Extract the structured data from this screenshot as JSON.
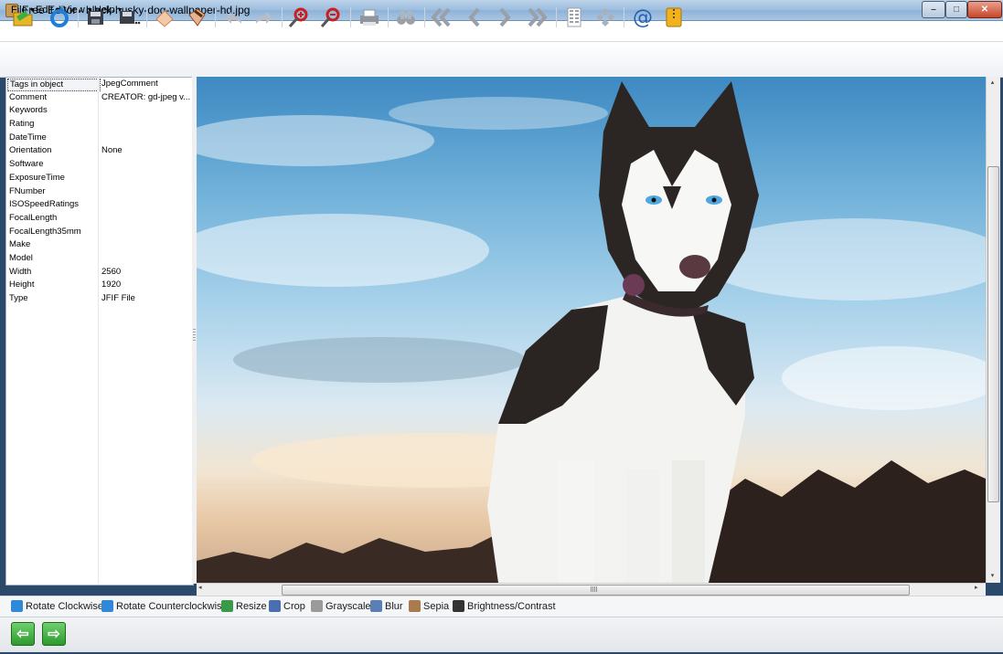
{
  "window": {
    "title": "Free Editor - black-husky-dog-wallpaper-hd.jpg",
    "controls": {
      "minimize": "–",
      "maximize": "□",
      "close": "✕"
    }
  },
  "menubar": [
    {
      "label": "File"
    },
    {
      "label": "Edit"
    },
    {
      "label": "View"
    },
    {
      "label": "Help"
    }
  ],
  "toolbar": {
    "icons": [
      "open-folder-icon",
      "refresh-icon",
      "save-icon",
      "save-as-icon",
      "eraser-icon",
      "paste-icon",
      "undo-icon",
      "redo-icon",
      "zoom-in-icon",
      "zoom-out-icon",
      "print-icon",
      "binoculars-icon",
      "first-icon",
      "previous-icon",
      "next-icon",
      "last-icon",
      "grid-icon",
      "fit-icon",
      "email-icon",
      "archive-icon"
    ]
  },
  "properties": {
    "header": {
      "key": "Tags in object",
      "value": "JpegComment"
    },
    "rows": [
      {
        "key": "Comment",
        "value": "CREATOR: gd-jpeg v..."
      },
      {
        "key": "Keywords",
        "value": ""
      },
      {
        "key": "Rating",
        "value": ""
      },
      {
        "key": "DateTime",
        "value": ""
      },
      {
        "key": "Orientation",
        "value": "None"
      },
      {
        "key": "Software",
        "value": ""
      },
      {
        "key": "ExposureTime",
        "value": ""
      },
      {
        "key": "FNumber",
        "value": ""
      },
      {
        "key": "ISOSpeedRatings",
        "value": ""
      },
      {
        "key": "FocalLength",
        "value": ""
      },
      {
        "key": "FocalLength35mm",
        "value": ""
      },
      {
        "key": "Make",
        "value": ""
      },
      {
        "key": "Model",
        "value": ""
      },
      {
        "key": "Width",
        "value": "2560"
      },
      {
        "key": "Height",
        "value": "1920"
      },
      {
        "key": "Type",
        "value": "JFIF File"
      }
    ]
  },
  "effects": [
    {
      "label": "Rotate Clockwise",
      "icon": "rotate-cw-icon",
      "color": "#2f88d8"
    },
    {
      "label": "Rotate Counterclockwise",
      "icon": "rotate-ccw-icon",
      "color": "#2f88d8"
    },
    {
      "label": "Resize",
      "icon": "resize-icon",
      "color": "#3a9a4a"
    },
    {
      "label": "Crop",
      "icon": "crop-icon",
      "color": "#4a6fb0"
    },
    {
      "label": "Grayscale",
      "icon": "grayscale-icon",
      "color": "#9a9a9a"
    },
    {
      "label": "Blur",
      "icon": "blur-icon",
      "color": "#5a7fb5"
    },
    {
      "label": "Sepia",
      "icon": "sepia-icon",
      "color": "#a87a4e"
    },
    {
      "label": "Brightness/Contrast",
      "icon": "brightness-contrast-icon",
      "color": "#333333"
    }
  ],
  "navigation": {
    "back": "⇦",
    "forward": "⇨",
    "accent": "#2b9a2b"
  },
  "scroll": {
    "horizontal_glyph": "|||",
    "left": "◂",
    "right": "▸",
    "up": "▴",
    "down": "▾",
    "vertical_grip": "≡"
  }
}
